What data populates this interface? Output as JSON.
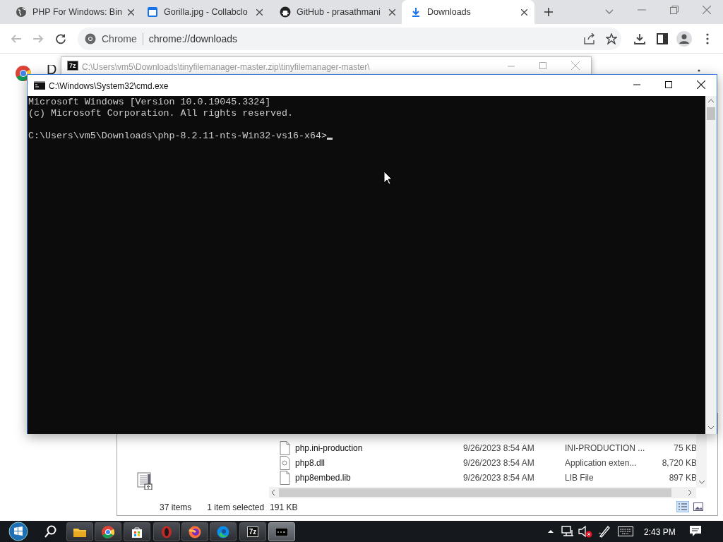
{
  "browser": {
    "tabs": [
      {
        "title": "PHP For Windows: Bin",
        "kind": "globe",
        "selected": false
      },
      {
        "title": "Gorilla.jpg - Collabclo",
        "kind": "document",
        "selected": false
      },
      {
        "title": "GitHub - prasathmani",
        "kind": "github",
        "selected": false
      },
      {
        "title": "Downloads",
        "kind": "download",
        "selected": true
      }
    ],
    "site_chip": "Chrome",
    "url": "chrome://downloads",
    "page_heading": "D"
  },
  "zip_window": {
    "icon_text": "7z",
    "title": "C:\\Users\\vm5\\Downloads\\tinyfilemanager-master.zip\\tinyfilemanager-master\\"
  },
  "explorer": {
    "rows": [
      {
        "name": "php.ini-production",
        "kind": "file",
        "modified": "9/26/2023 8:54 AM",
        "type": "INI-PRODUCTION ...",
        "size": "75 KB"
      },
      {
        "name": "php8.dll",
        "kind": "dll",
        "modified": "9/26/2023 8:54 AM",
        "type": "Application exten...",
        "size": "8,720 KB"
      },
      {
        "name": "php8embed.lib",
        "kind": "file",
        "modified": "9/26/2023 8:54 AM",
        "type": "LIB File",
        "size": "897 KB"
      }
    ],
    "status": {
      "count": "37 items",
      "selection": "1 item selected",
      "size": "191 KB"
    }
  },
  "cmd": {
    "title": "C:\\Windows\\System32\\cmd.exe",
    "output": [
      "Microsoft Windows [Version 10.0.19045.3324]",
      "(c) Microsoft Corporation. All rights reserved."
    ],
    "prompt": "C:\\Users\\vm5\\Downloads\\php-8.2.11-nts-Win32-vs16-x64>"
  },
  "taskbar": {
    "apps": [
      {
        "kind": "explorer",
        "active": false
      },
      {
        "kind": "chrome",
        "active": false
      },
      {
        "kind": "store",
        "active": false
      },
      {
        "kind": "red",
        "active": false
      },
      {
        "kind": "firefox",
        "active": false
      },
      {
        "kind": "edge",
        "active": false
      },
      {
        "kind": "sevenzip",
        "label": "7z",
        "active": false
      },
      {
        "kind": "cmd",
        "active": true
      }
    ],
    "clock": "2:43 PM"
  }
}
